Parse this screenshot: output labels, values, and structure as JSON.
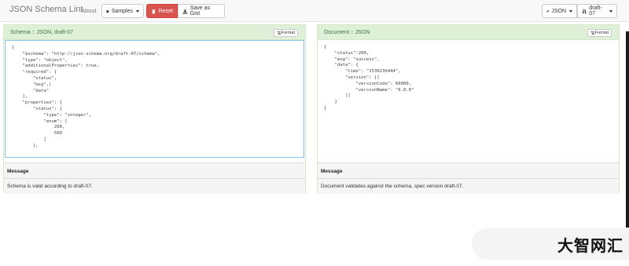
{
  "navbar": {
    "brand": "JSON Schema Lint",
    "about": "About",
    "samples": "Samples",
    "reset": "Reset",
    "save_gist": "Save as Gist",
    "format_select": "JSON",
    "draft_select": "draft-07"
  },
  "schema_panel": {
    "title": "Schema :: JSON, draft-07",
    "format_label": "Format",
    "code": "{\n    \"$schema\": \"http://json-schema.org/draft-07/schema\",\n    \"type\": \"object\",\n    \"additionalProperties\": true,\n    \"required\": [\n        \"status\",\n        \"msg\",|\n        \"data\"\n    ],\n    \"properties\": {\n        \"status\": {\n            \"type\": \"integer\",\n            \"enum\": [\n                200,\n                500\n            ]\n        },",
    "message_label": "Message",
    "message": "Schema is valid according to draft-07."
  },
  "document_panel": {
    "title": "Document :: JSON",
    "format_label": "Format",
    "code": "{\n    \"status\":200,\n    \"msg\": \"success\",\n    \"data\": {\n        \"time\": \"1530236444\",\n        \"version\": [[\n            \"versionCode\": 60000,\n            \"versionName\": \"6.0.0\"\n        ]]\n    }\n}",
    "message_label": "Message",
    "message": "Document validates against the schema, spec version draft-07."
  },
  "watermark": "大智网汇",
  "colors": {
    "reset_bg": "#d9534f",
    "panel_heading_bg": "#dff0d8",
    "panel_title": "#3c763d",
    "editor_focus_border": "#8ac3e8"
  }
}
